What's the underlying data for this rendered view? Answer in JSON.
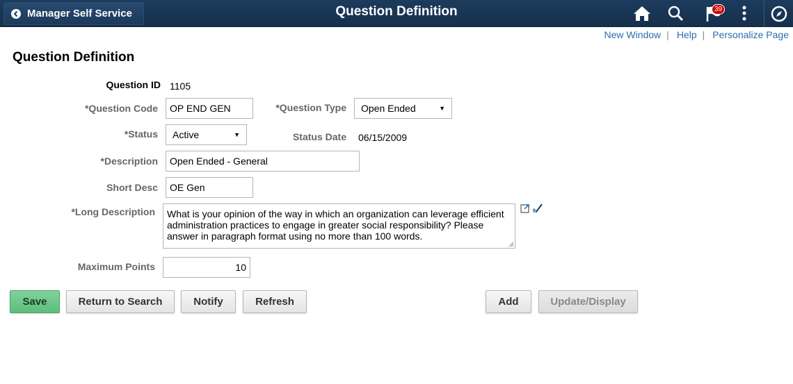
{
  "header": {
    "back_label": "Manager Self Service",
    "title": "Question Definition",
    "notification_count": "39",
    "icons": [
      "home-icon",
      "search-icon",
      "notification-flag-icon",
      "actions-menu-icon",
      "navbar-compass-icon"
    ]
  },
  "links": {
    "new_window": "New Window",
    "help": "Help",
    "personalize": "Personalize Page",
    "separator": "|"
  },
  "page_title": "Question Definition",
  "form": {
    "question_id_label": "Question ID",
    "question_id_value": "1105",
    "question_code_label": "*Question Code",
    "question_code_value": "OP END GEN",
    "question_type_label": "*Question Type",
    "question_type_value": "Open Ended",
    "status_label": "*Status",
    "status_value": "Active",
    "status_date_label": "Status Date",
    "status_date_value": "06/15/2009",
    "description_label": "*Description",
    "description_value": "Open Ended - General",
    "short_desc_label": "Short Desc",
    "short_desc_value": "OE Gen",
    "long_description_label": "*Long Description",
    "long_description_value": "What is your opinion of the way in which an organization can leverage efficient administration practices to engage in greater social responsibility? Please answer in paragraph format using no more than 100 words.",
    "max_points_label": "Maximum Points",
    "max_points_value": "10"
  },
  "buttons": {
    "save": "Save",
    "return_to_search": "Return to Search",
    "notify": "Notify",
    "refresh": "Refresh",
    "add": "Add",
    "update_display": "Update/Display"
  },
  "colors": {
    "header_bg": "#1d3b5c",
    "link": "#2d6cae",
    "save_button": "#6cc88a",
    "badge": "#d40000"
  }
}
